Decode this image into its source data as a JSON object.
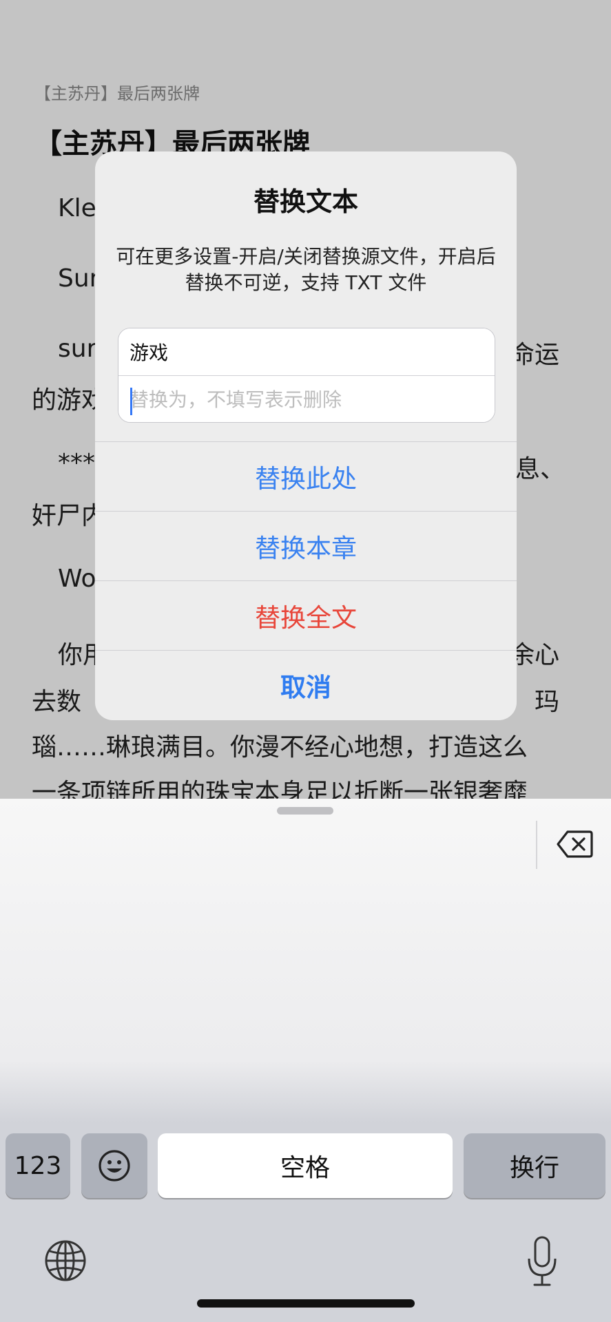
{
  "reader": {
    "header": "【主苏丹】最后两张牌",
    "title": "【主苏丹】最后两张牌",
    "lines": [
      "Kle",
      "Sur",
      "sur",
      "命运",
      "的游戏",
      "***",
      "息、",
      "奸尸内",
      "Wo",
      "你用",
      "余心",
      "去数",
      "玛",
      "瑙……琳琅满目。你漫不经心地想，打造这么",
      "一条项链所用的珠宝本身足以折断一张银奢靡"
    ]
  },
  "dialog": {
    "title": "替换文本",
    "message": "可在更多设置-开启/关闭替换源文件，开启后替换不可逆，支持 TXT 文件",
    "find_value": "游戏",
    "replace_placeholder": "替换为，不填写表示删除",
    "replace_here": "替换此处",
    "replace_chapter": "替换本章",
    "replace_all": "替换全文",
    "cancel": "取消"
  },
  "keyboard": {
    "numbers_key": "123",
    "emoji_icon": "emoji-icon",
    "space_key": "空格",
    "return_key": "换行",
    "delete_icon": "delete-backward-icon",
    "globe_icon": "globe-icon",
    "mic_icon": "microphone-icon"
  },
  "colors": {
    "action_blue": "#3a82f0",
    "action_red": "#e8463a",
    "caret": "#3478f6"
  }
}
